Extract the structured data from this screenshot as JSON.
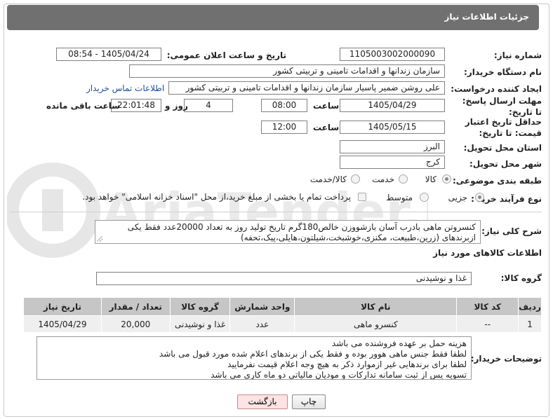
{
  "header": {
    "title": "جزئیات اطلاعات نیاز"
  },
  "watermark": {
    "text": "AriaTender.neT"
  },
  "fields": {
    "need_number_label": "شماره نیاز:",
    "need_number": "1105003002000090",
    "announce_label": "تاریخ و ساعت اعلان عمومی:",
    "announce_value": "1405/04/24 - 08:54",
    "buyer_org_label": "نام دستگاه خریدار:",
    "buyer_org": "سازمان زندانها و اقدامات تامینی و تربیتی کشور",
    "creator_label": "ایجاد کننده درخواست:",
    "creator": "علی روشن ضمیر پاسیار سازمان زندانها و اقدامات تامینی و تربیتی کشور",
    "contact_link": "اطلاعات تماس خریدار",
    "reply_deadline_label": "مهلت ارسال پاسخ: تا تاریخ:",
    "reply_date": "1405/04/29",
    "time_label": "ساعت",
    "reply_time": "08:00",
    "days_value": "4",
    "days_label": "روز و",
    "remaining_time": "22:01:48",
    "remaining_label": "ساعت باقی مانده",
    "price_validity_label": "حداقل تاریخ اعتبار قیمت: تا تاریخ:",
    "price_date": "1405/05/15",
    "price_time": "12:00",
    "province_label": "استان محل تحویل:",
    "province": "البرز",
    "city_label": "شهر محل تحویل:",
    "city": "کرج",
    "category_label": "طبقه بندی موضوعی:",
    "category_options": [
      "کالا",
      "خدمت",
      "کالا/خدمت"
    ],
    "process_label": "نوع فرآیند خرید :",
    "process_options": [
      "جزیی",
      "متوسط"
    ],
    "payment_note": "پرداخت تمام یا بخشی از مبلغ خرید،از محل \"اسناد خزانه اسلامی\" خواهد بود."
  },
  "description": {
    "label": "شرح کلی نیاز:",
    "text": "کنسروتن ماهی بادرب آسان بازشووزن خالص180گرم تاریخ تولید روز به تعداد 20000عدد فقط یکی ازبرندهای (زرین،طبیعت، مکنزی،خوشبخت،شیلتون،هایلی،پیک،تحفه)"
  },
  "goods": {
    "section_title": "اطلاعات کالاهای مورد نیاز",
    "group_label": "گروه کالا:",
    "group_value": "غذا و نوشیدنی",
    "columns": [
      "ردیف",
      "کد کالا",
      "نام کالا",
      "واحد شمارش",
      "گروه کالا",
      "تعداد / مقدار",
      "تاریخ نیاز"
    ],
    "rows": [
      [
        "1",
        "--",
        "کنسرو ماهی",
        "عدد",
        "غذا و نوشیدنی",
        "20,000",
        "1405/04/29"
      ]
    ]
  },
  "buyer_notes": {
    "label": "توضیحات خریدار:",
    "lines": [
      "هزینه حمل بر عهده فروشنده می باشد",
      "لطفا فقط جنس ماهی هوور بوده و فقط یکی از برندهای اعلام شده مورد قبول می باشد",
      "لطفا برای برندهایی غیر ازموارد ذکر به هیچ وجه اعلام قیمت نفرمایید",
      "تسویه پس از ثبت سامانه تدارکات و مودیان مالیاتی دو ماه کاری  می باشد"
    ]
  },
  "buttons": {
    "print": "چاپ",
    "back": "بازگشت"
  }
}
